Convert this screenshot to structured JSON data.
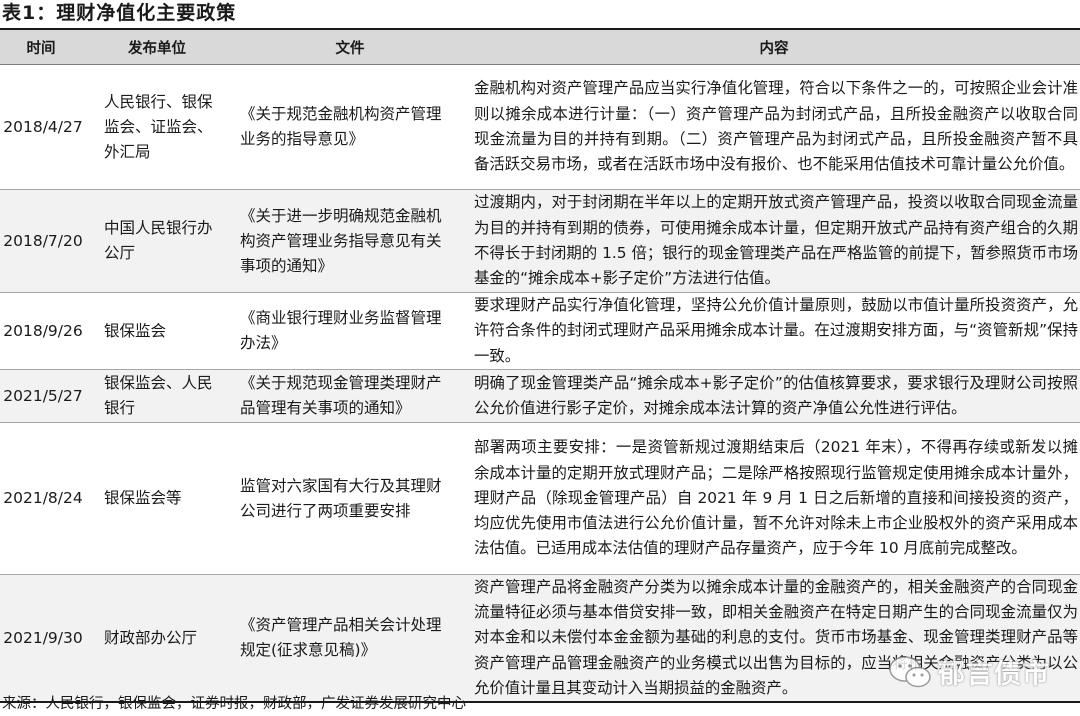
{
  "title": "表1：理财净值化主要政策",
  "headers": {
    "date": "时间",
    "publisher": "发布单位",
    "document": "文件",
    "content": "内容"
  },
  "rows": [
    {
      "date": "2018/4/27",
      "publisher": "人民银行、银保监会、证监会、外汇局",
      "document": "《关于规范金融机构资产管理业务的指导意见》",
      "content": "金融机构对资产管理产品应当实行净值化管理，符合以下条件之一的，可按照企业会计准则以摊余成本进行计量：（一）资产管理产品为封闭式产品，且所投金融资产以收取合同现金流量为目的并持有到期。（二）资产管理产品为封闭式产品，且所投金融资产暂不具备活跃交易市场，或者在活跃市场中没有报价、也不能采用估值技术可靠计量公允价值。"
    },
    {
      "date": "2018/7/20",
      "publisher": "中国人民银行办公厅",
      "document": "《关于进一步明确规范金融机构资产管理业务指导意见有关事项的通知》",
      "content": "过渡期内，对于封闭期在半年以上的定期开放式资产管理产品，投资以收取合同现金流量为目的并持有到期的债券，可使用摊余成本计量，但定期开放式产品持有资产组合的久期不得长于封闭期的 1.5 倍；银行的现金管理类产品在严格监管的前提下，暂参照货币市场基金的“摊余成本+影子定价”方法进行估值。"
    },
    {
      "date": "2018/9/26",
      "publisher": "银保监会",
      "document": "《商业银行理财业务监督管理办法》",
      "content": "要求理财产品实行净值化管理，坚持公允价值计量原则，鼓励以市值计量所投资资产，允许符合条件的封闭式理财产品采用摊余成本计量。在过渡期安排方面，与“资管新规”保持一致。"
    },
    {
      "date": "2021/5/27",
      "publisher": "银保监会、人民银行",
      "document": "《关于规范现金管理类理财产品管理有关事项的通知》",
      "content": "明确了现金管理类产品“摊余成本+影子定价”的估值核算要求，要求银行及理财公司按照公允价值进行影子定价，对摊余成本法计算的资产净值公允性进行评估。"
    },
    {
      "date": "2021/8/24",
      "publisher": "银保监会等",
      "document": "监管对六家国有大行及其理财公司进行了两项重要安排",
      "content": "部署两项主要安排：一是资管新规过渡期结束后（2021 年末），不得再存续或新发以摊余成本计量的定期开放式理财产品；二是除严格按照现行监管规定使用摊余成本计量外，理财产品（除现金管理产品）自 2021 年 9 月 1 日之后新增的直接和间接投资的资产，均应优先使用市值法进行公允价值计量，暂不允许对除未上市企业股权外的资产采用成本法估值。已适用成本法估值的理财产品存量资产，应于今年 10 月底前完成整改。"
    },
    {
      "date": "2021/9/30",
      "publisher": "财政部办公厅",
      "document": "《资产管理产品相关会计处理规定(征求意见稿)》",
      "content": "资产管理产品将金融资产分类为以摊余成本计量的金融资产的，相关金融资产的合同现金流量特征必须与基本借贷安排一致，即相关金融资产在特定日期产生的合同现金流量仅为对本金和以未偿付本金金额为基础的利息的支付。货币市场基金、现金管理类理财产品等资产管理产品管理金融资产的业务模式以出售为目标的，应当将相关金融资产分类为以公允价值计量且其变动计入当期损益的金融资产。"
    }
  ],
  "source": "来源：人民银行，银保监会，证券时报，财政部，广发证券发展研究中心",
  "watermark": {
    "text": "郁言债市",
    "icon": "wechat-icon"
  },
  "colors": {
    "header_bg": "#d9d9d9",
    "alt_row_bg": "#f2f2f2",
    "rule": "#1a1a1a"
  }
}
